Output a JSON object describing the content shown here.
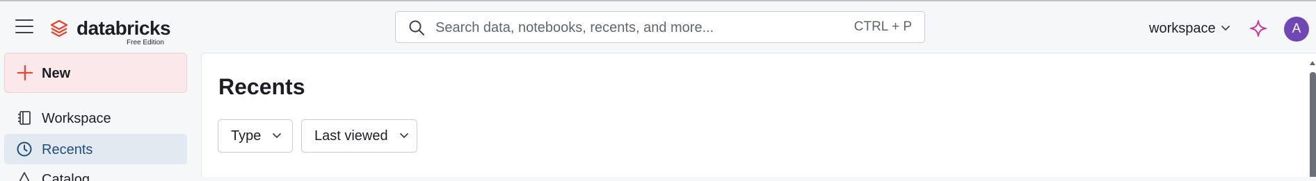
{
  "header": {
    "logo_word": "databricks",
    "logo_sub": "Free Edition",
    "search_placeholder": "Search data, notebooks, recents, and more...",
    "search_shortcut": "CTRL + P",
    "workspace_label": "workspace",
    "avatar_initial": "A"
  },
  "sidebar": {
    "new_label": "New",
    "items": [
      {
        "label": "Workspace",
        "icon": "workspace-icon"
      },
      {
        "label": "Recents",
        "icon": "clock-icon",
        "active": true
      },
      {
        "label": "Catalog",
        "icon": "catalog-icon"
      }
    ]
  },
  "main": {
    "title": "Recents",
    "filters": [
      {
        "label": "Type"
      },
      {
        "label": "Last viewed"
      }
    ]
  },
  "colors": {
    "brand_logo": "#e8432c",
    "avatar": "#6f47b6",
    "active_nav_text": "#1d4e7c",
    "new_button_bg": "#fae8ea",
    "assistant_icon": "#c53a9a"
  }
}
